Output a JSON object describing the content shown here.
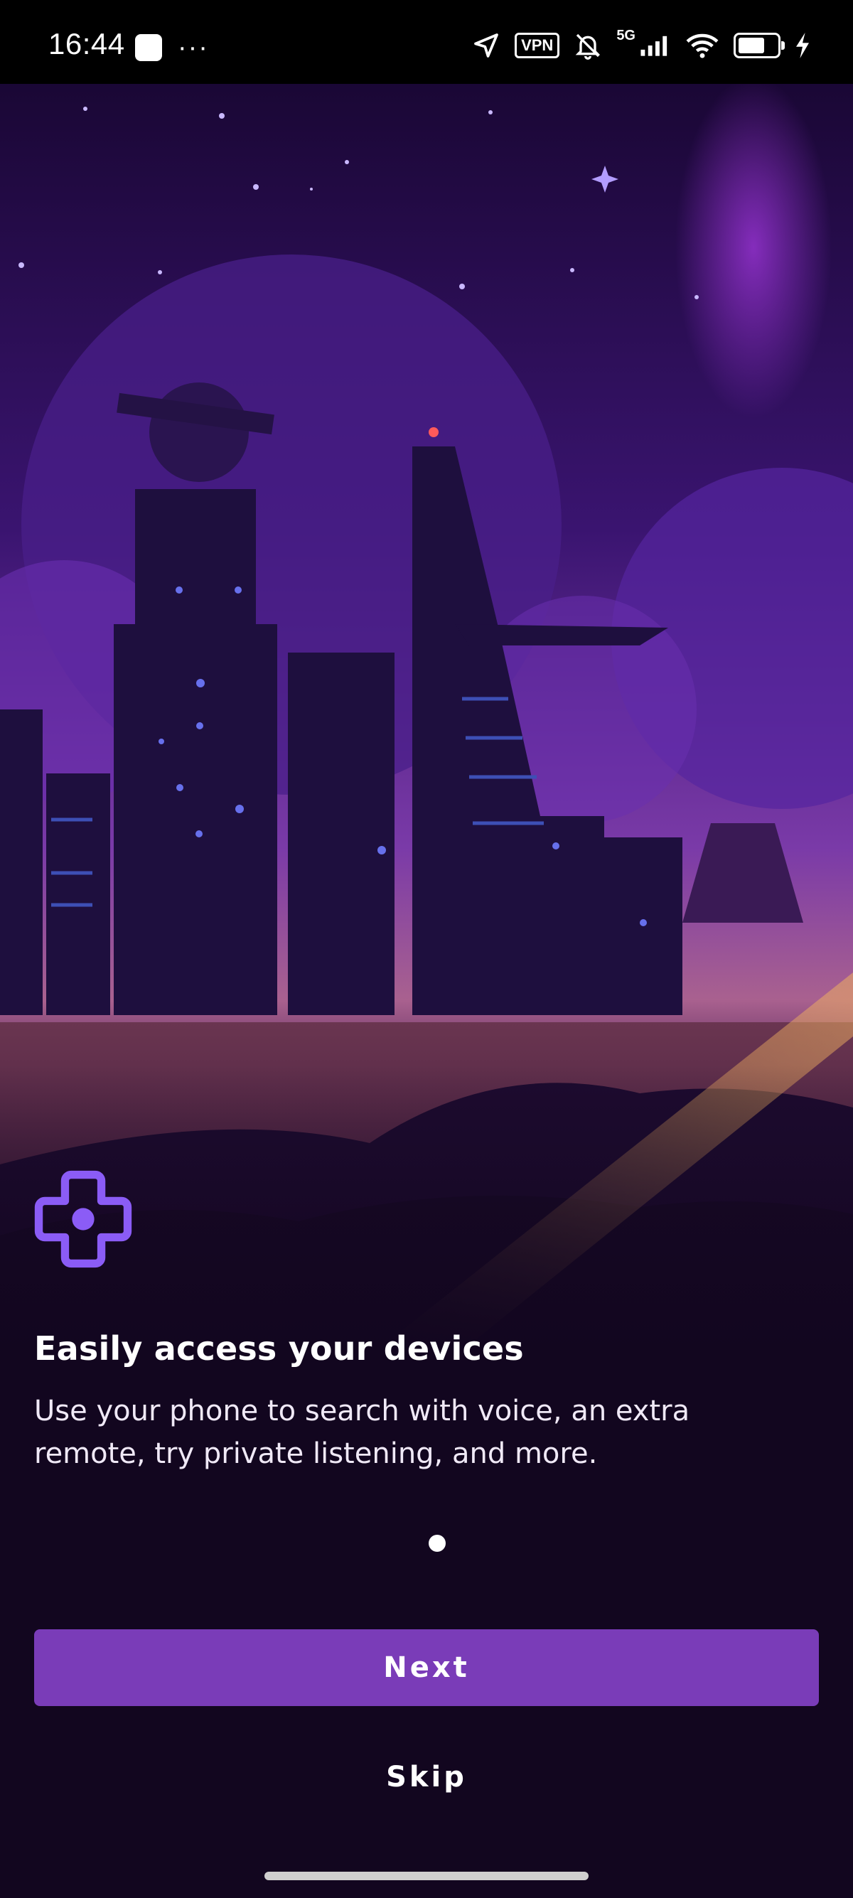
{
  "status_bar": {
    "time": "16:44",
    "vpn_label": "VPN",
    "network_label": "5G",
    "icons": [
      "notification-square-icon",
      "more-dots-icon",
      "location-arrow-icon",
      "vpn-icon",
      "muted-bell-icon",
      "signal-icon",
      "wifi-icon",
      "battery-icon",
      "charging-bolt-icon"
    ]
  },
  "onboarding": {
    "feature_icon": "dpad-remote-icon",
    "title": "Easily access your devices",
    "description": "Use your phone to search with voice, an extra remote, try private listening, and more.",
    "page_count": 1,
    "current_page": 1
  },
  "actions": {
    "next_label": "Next",
    "skip_label": "Skip"
  },
  "colors": {
    "accent": "#7a3cb8",
    "icon": "#8b5cf6",
    "background": "#12061f"
  }
}
